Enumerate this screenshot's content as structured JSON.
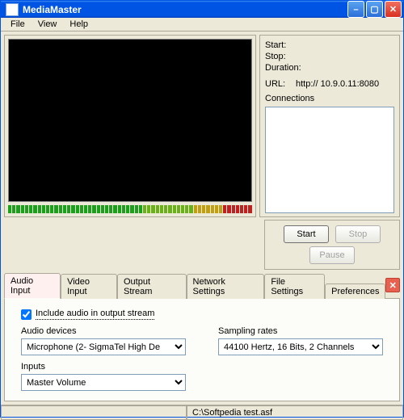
{
  "window": {
    "title": "MediaMaster"
  },
  "menu": {
    "file": "File",
    "view": "View",
    "help": "Help"
  },
  "info": {
    "start_k": "Start:",
    "start_v": "",
    "stop_k": "Stop:",
    "stop_v": "",
    "duration_k": "Duration:",
    "duration_v": "",
    "url_k": "URL:",
    "url_v": "http:// 10.9.0.11:8080",
    "connections_k": "Connections"
  },
  "controls": {
    "start": "Start",
    "stop": "Stop",
    "pause": "Pause"
  },
  "tabs": {
    "audio_input": "Audio Input",
    "video_input": "Video Input",
    "output_stream": "Output Stream",
    "network_settings": "Network Settings",
    "file_settings": "File  Settings",
    "preferences": "Preferences"
  },
  "audio": {
    "include_label": "Include audio in output stream",
    "devices_label": "Audio devices",
    "device_value": "Microphone (2- SigmaTel High De",
    "rates_label": "Sampling rates",
    "rate_value": "44100 Hertz, 16 Bits, 2 Channels",
    "inputs_label": "Inputs",
    "input_value": "Master Volume"
  },
  "status": {
    "path": "C:\\Softpedia test.asf"
  }
}
